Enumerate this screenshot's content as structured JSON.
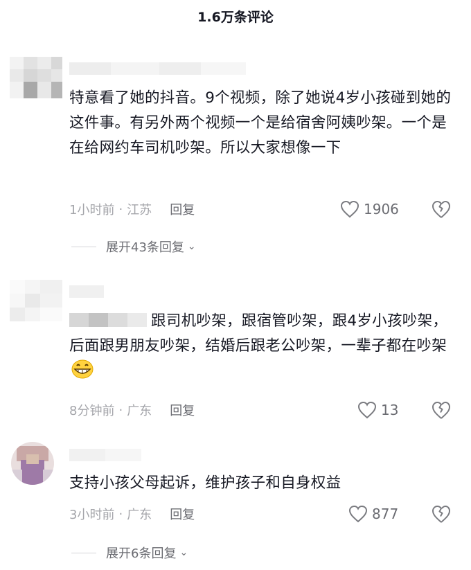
{
  "header": {
    "title": "1.6万条评论"
  },
  "comments": [
    {
      "text": "特意看了她的抖音。9个视频，除了她说4岁小孩碰到她的这件事。有另外两个视频一个是给宿舍阿姨吵架。一个是在给网约车司机吵架。所以大家想像一下",
      "time": "1小时前",
      "location": "江苏",
      "reply_label": "回复",
      "likes": "1906",
      "expand_label": "展开43条回复"
    },
    {
      "text": "跟司机吵架，跟宿管吵架，跟4岁小孩吵架，后面跟男朋友吵架，结婚后跟老公吵架，一辈子都在吵架",
      "emoji": "grinning-face-icon",
      "time": "8分钟前",
      "location": "广东",
      "reply_label": "回复",
      "likes": "13"
    },
    {
      "text": "支持小孩父母起诉，维护孩子和自身权益",
      "time": "3小时前",
      "location": "广东",
      "reply_label": "回复",
      "likes": "877",
      "expand_label": "展开6条回复"
    }
  ],
  "separator": "·",
  "colors": {
    "text": "#161823",
    "meta": "#a4a5aa",
    "secondary": "#6b6c72",
    "icon": "#7a7b80"
  }
}
